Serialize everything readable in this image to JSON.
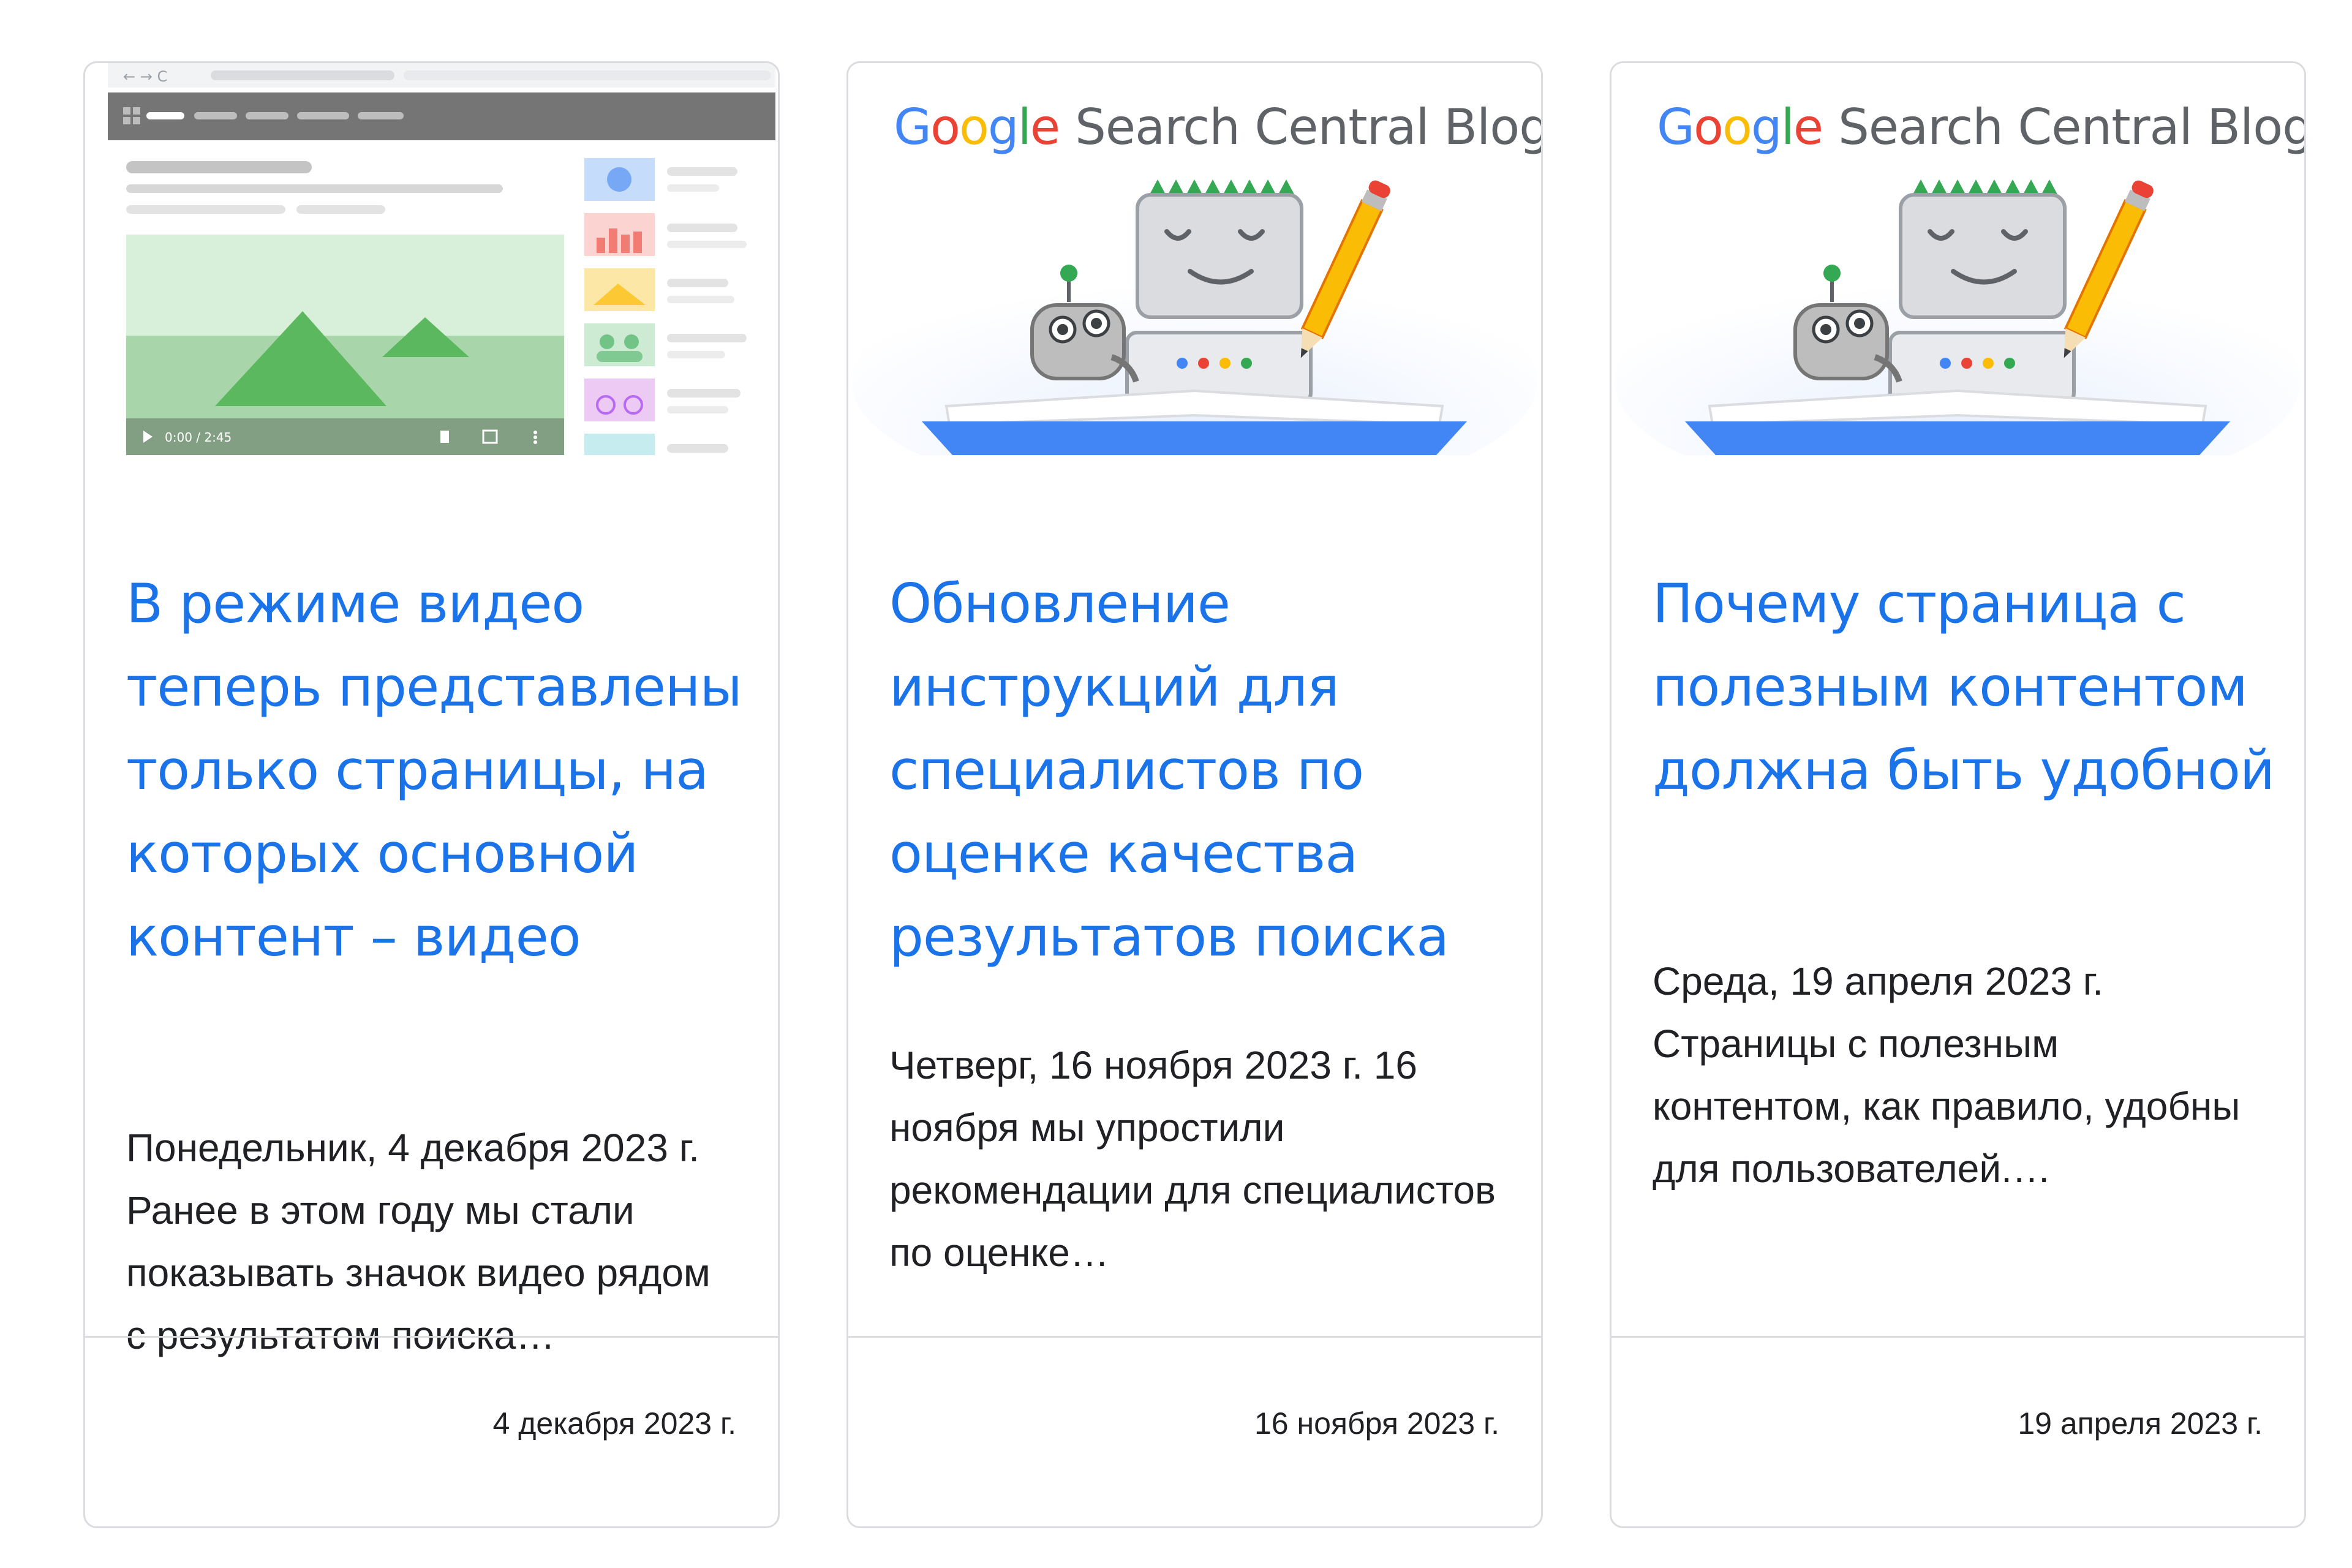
{
  "cards": [
    {
      "title": "В режиме видео теперь представлены только страницы, на которых основной контент – видео",
      "snippet": "Понедельник, 4 декабря 2023 г. Ранее в этом году мы стали показывать значок видео рядом с результатом поиска…",
      "date": "4 декабря 2023 г.",
      "thumbnail": {
        "type": "video-mode-mockup",
        "video_time": "0:00 / 2:45",
        "icons": [
          "play-icon",
          "volume-icon",
          "fullscreen-icon",
          "more-icon"
        ]
      }
    },
    {
      "title": "Обновление инструкций для специалистов по оценке качества результатов поиска",
      "snippet": "Четверг, 16 ноября 2023 г. 16 ноября мы упростили рекомендации для специалистов по оценке…",
      "date": "16 ноября 2023 г.",
      "thumbnail": {
        "type": "blog-logo",
        "logo_google": "Google",
        "logo_text": "Search Central Blog"
      }
    },
    {
      "title": "Почему страница с полезным контентом должна быть удобной",
      "snippet": "Среда, 19 апреля 2023 г. Страницы с полезным контентом, как правило, удобны для пользователей.…",
      "date": "19 апреля 2023 г.",
      "thumbnail": {
        "type": "blog-logo",
        "logo_google": "Google",
        "logo_text": "Search Central Blog"
      }
    }
  ],
  "colors": {
    "title_link": "#1a73e8",
    "body_text": "#202124",
    "card_border": "#dadce0",
    "google_blue": "#4285f4",
    "google_red": "#ea4335",
    "google_yellow": "#fbbc05",
    "google_green": "#34a853"
  }
}
